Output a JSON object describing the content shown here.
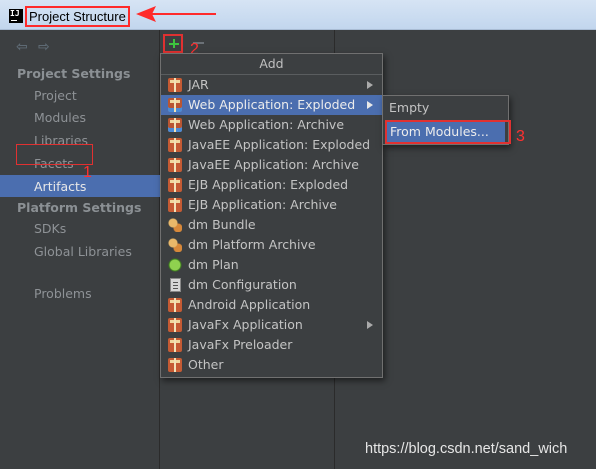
{
  "window": {
    "title": "Project Structure"
  },
  "left_panel": {
    "sections": [
      {
        "label": "Project Settings",
        "items": [
          "Project",
          "Modules",
          "Libraries",
          "Facets",
          "Artifacts"
        ]
      },
      {
        "label": "Platform Settings",
        "items": [
          "SDKs",
          "Global Libraries"
        ]
      }
    ],
    "extra_item": "Problems",
    "selected_item": "Artifacts"
  },
  "toolbar": {
    "add_icon": "plus-icon",
    "remove_icon": "minus-icon"
  },
  "add_menu": {
    "header": "Add",
    "items": [
      {
        "label": "JAR",
        "icon": "jar-icon",
        "submenu": true
      },
      {
        "label": "Web Application: Exploded",
        "icon": "web-app-icon",
        "submenu": true,
        "active": true
      },
      {
        "label": "Web Application: Archive",
        "icon": "web-app-icon"
      },
      {
        "label": "JavaEE Application: Exploded",
        "icon": "jar-icon"
      },
      {
        "label": "JavaEE Application: Archive",
        "icon": "jar-icon"
      },
      {
        "label": "EJB Application: Exploded",
        "icon": "jar-icon"
      },
      {
        "label": "EJB Application: Archive",
        "icon": "jar-icon"
      },
      {
        "label": "dm Bundle",
        "icon": "bundle-icon"
      },
      {
        "label": "dm Platform Archive",
        "icon": "bundle-icon"
      },
      {
        "label": "dm Plan",
        "icon": "plan-icon"
      },
      {
        "label": "dm Configuration",
        "icon": "config-icon"
      },
      {
        "label": "Android Application",
        "icon": "jar-icon"
      },
      {
        "label": "JavaFx Application",
        "icon": "jar-icon",
        "submenu": true
      },
      {
        "label": "JavaFx Preloader",
        "icon": "jar-icon"
      },
      {
        "label": "Other",
        "icon": "jar-icon"
      }
    ]
  },
  "sub_menu": {
    "items": [
      {
        "label": "Empty"
      },
      {
        "label": "From Modules...",
        "active": true
      }
    ]
  },
  "annotations": {
    "n1": "1",
    "n2": "2",
    "n3": "3",
    "color": "#ff3030"
  },
  "watermark": "https://blog.csdn.net/sand_wich",
  "colors": {
    "background": "#3c3f41",
    "selection": "#4b6eaf",
    "titlebar": "#c9dcf1"
  }
}
